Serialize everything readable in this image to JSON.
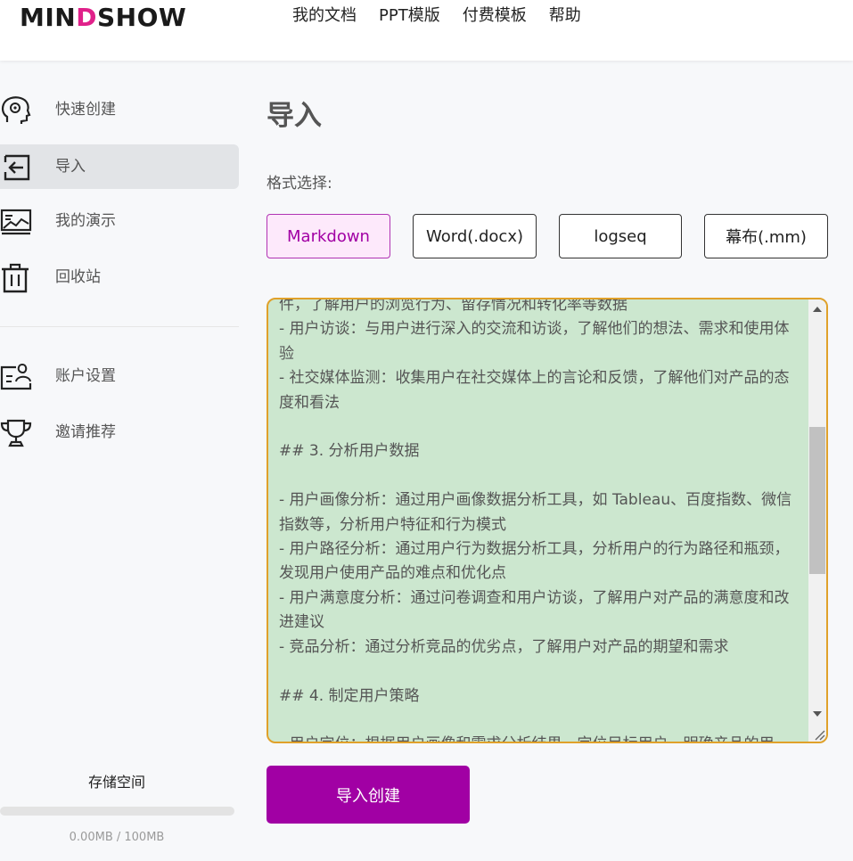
{
  "app": {
    "logo_text_a": "MIN",
    "logo_text_b": "D",
    "logo_text_c": "SHOW"
  },
  "nav": {
    "items": [
      "我的文档",
      "PPT模版",
      "付费模板",
      "帮助"
    ]
  },
  "sidebar": {
    "items": [
      {
        "label": "快速创建",
        "icon": "brain-head-icon",
        "active": false
      },
      {
        "label": "导入",
        "icon": "import-arrow-icon",
        "active": true
      },
      {
        "label": "我的演示",
        "icon": "presentation-chart-icon",
        "active": false
      },
      {
        "label": "回收站",
        "icon": "trash-icon",
        "active": false
      },
      {
        "label": "账户设置",
        "icon": "account-settings-icon",
        "active": false
      },
      {
        "label": "邀请推荐",
        "icon": "trophy-icon",
        "active": false
      }
    ],
    "storage": {
      "title": "存储空间",
      "usage_text": "0.00MB / 100MB",
      "used_fraction": 0
    }
  },
  "main": {
    "title": "导入",
    "format_label": "格式选择:",
    "formats": [
      {
        "label": "Markdown",
        "selected": true
      },
      {
        "label": "Word(.docx)",
        "selected": false
      },
      {
        "label": "logseq",
        "selected": false
      },
      {
        "label": "幕布(.mm)",
        "selected": false
      }
    ],
    "editor_text": "件，了解用户的浏览行为、留存情况和转化率等数据\n- 用户访谈：与用户进行深入的交流和访谈，了解他们的想法、需求和使用体验\n- 社交媒体监测：收集用户在社交媒体上的言论和反馈，了解他们对产品的态度和看法\n\n## 3. 分析用户数据\n\n- 用户画像分析：通过用户画像数据分析工具，如 Tableau、百度指数、微信指数等，分析用户特征和行为模式\n- 用户路径分析：通过用户行为数据分析工具，分析用户的行为路径和瓶颈，发现用户使用产品的难点和优化点\n- 用户满意度分析：通过问卷调查和用户访谈，了解用户对产品的满意度和改进建议\n- 竞品分析：通过分析竞品的优劣点，了解用户对产品的期望和需求\n\n## 4. 制定用户策略\n\n- 用户定位：根据用户画像和需求分析结果，定位目标用户，明确产品的用",
    "import_button": "导入创建"
  },
  "colors": {
    "brand": "#a100a4",
    "accent_pink": "#e0218a",
    "editor_bg": "#cce7cf",
    "editor_border": "#e0a12a"
  }
}
